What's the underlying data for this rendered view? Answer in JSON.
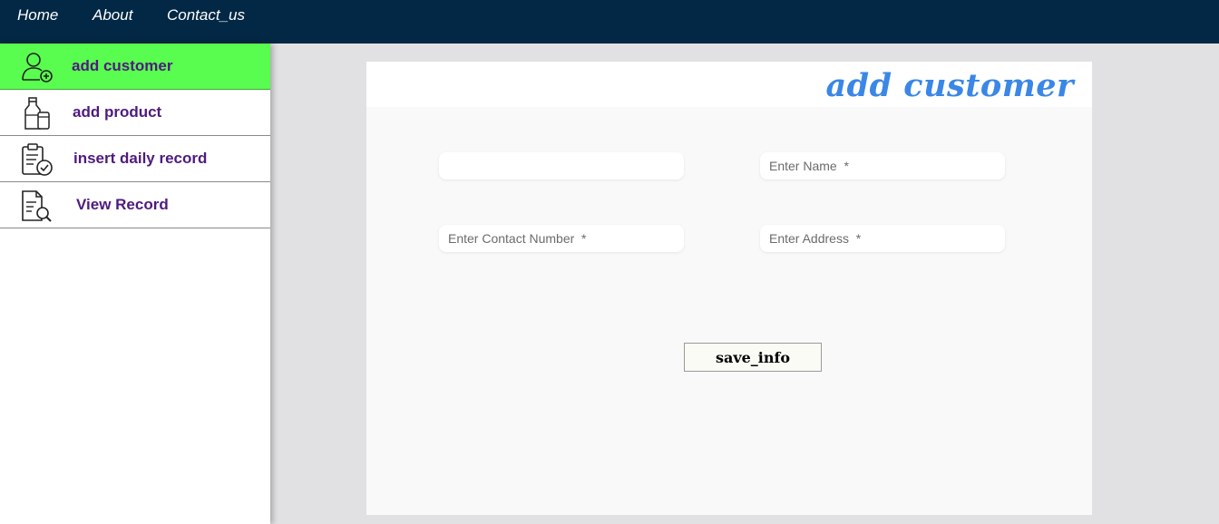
{
  "topnav": {
    "items": [
      {
        "label": "Home"
      },
      {
        "label": "About"
      },
      {
        "label": "Contact_us"
      }
    ]
  },
  "sidebar": {
    "items": [
      {
        "label": "add customer",
        "icon": "add-user-icon",
        "active": true
      },
      {
        "label": "add product",
        "icon": "milk-bottle-icon",
        "active": false
      },
      {
        "label": "insert daily record",
        "icon": "clipboard-check-icon",
        "active": false
      },
      {
        "label": "View Record",
        "icon": "document-search-icon",
        "active": false
      }
    ]
  },
  "form": {
    "title": "add customer",
    "fields": {
      "id": {
        "value": "",
        "placeholder": ""
      },
      "name": {
        "value": "",
        "placeholder": "Enter Name  *"
      },
      "contact": {
        "value": "",
        "placeholder": "Enter Contact Number  *"
      },
      "address": {
        "value": "",
        "placeholder": "Enter Address  *"
      }
    },
    "save_label": "save_info"
  },
  "colors": {
    "topnav_bg": "#022845",
    "sidebar_active": "#59fd4f",
    "sidebar_label": "#4f1a7f",
    "title": "#3a87e6",
    "page_bg": "#e1e1e3"
  }
}
